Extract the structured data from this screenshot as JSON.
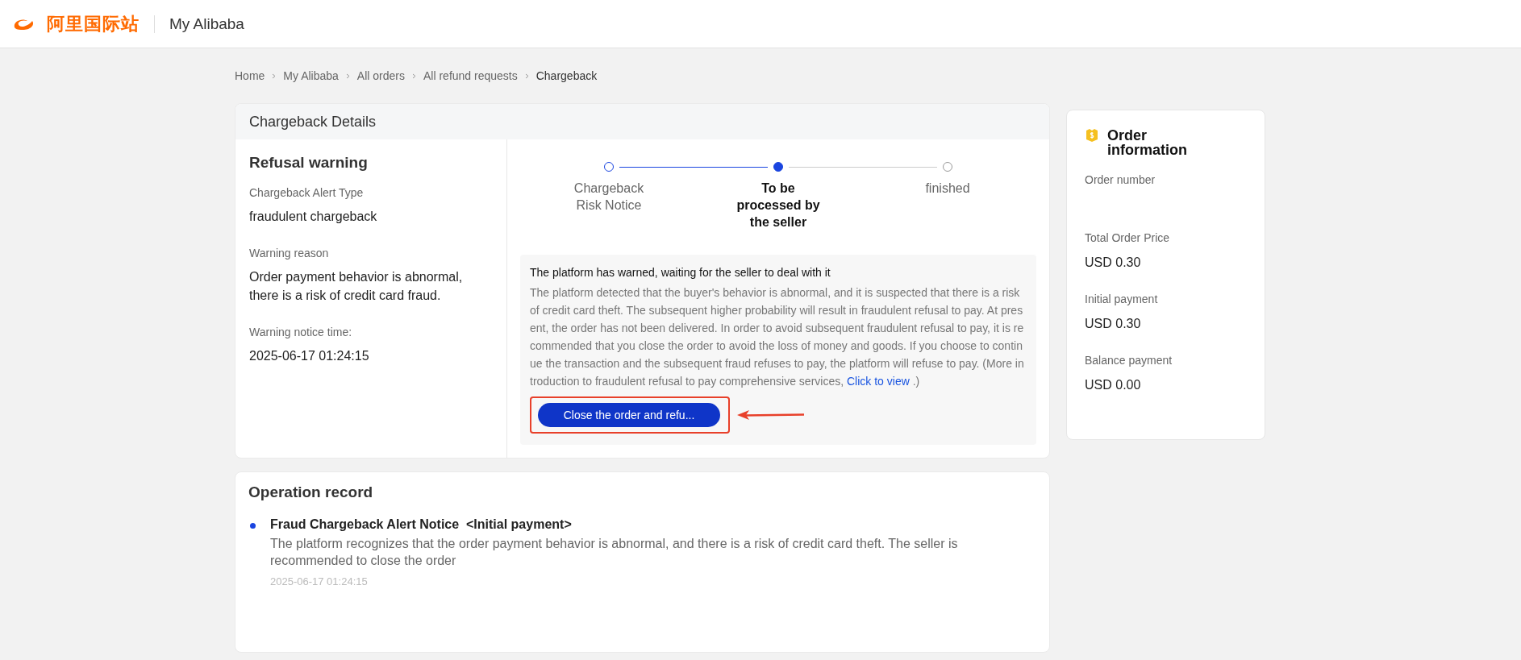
{
  "header": {
    "logo_text": "阿里国际站",
    "title": "My Alibaba"
  },
  "breadcrumb": [
    {
      "label": "Home",
      "current": false
    },
    {
      "label": "My Alibaba",
      "current": false
    },
    {
      "label": "All orders",
      "current": false
    },
    {
      "label": "All refund requests",
      "current": false
    },
    {
      "label": "Chargeback",
      "current": true
    }
  ],
  "details": {
    "title": "Chargeback Details",
    "summary": {
      "title": "Refusal warning",
      "fields": [
        {
          "label": "Chargeback Alert Type",
          "value": "fraudulent chargeback"
        },
        {
          "label": "Warning reason",
          "value": "Order payment behavior is abnormal, there is a risk of credit card fraud."
        },
        {
          "label": "Warning notice time:",
          "value": "2025-06-17 01:24:15"
        }
      ]
    },
    "steps": [
      {
        "label": "Chargeback Risk Notice",
        "completed": true,
        "selected": false
      },
      {
        "label": "To be processed by the seller",
        "completed": false,
        "selected": true
      },
      {
        "label": "finished",
        "completed": false,
        "selected": false
      }
    ],
    "notice": {
      "title": "The platform has warned, waiting for the seller to deal with it",
      "text": "The platform detected that the buyer's behavior is abnormal, and it is suspected that there is a risk of credit card theft. The subsequent higher probability will result in fraudulent refusal to pay. At present, the order has not been delivered. In order to avoid subsequent fraudulent refusal to pay, it is recommended that you close the order to avoid the loss of money and goods. If you choose to continue the transaction and the subsequent fraud refuses to pay, the platform will refuse to pay. (More introduction to fraudulent refusal to pay comprehensive services, ",
      "link": "Click to view",
      "after": " .)",
      "button": {
        "label": "Close the order and refu...",
        "highlighted": true
      }
    }
  },
  "order_info": {
    "title": "Order information",
    "items": [
      {
        "label": "Order number"
      },
      {
        "label": "Total Order Price",
        "value": "USD 0.30"
      },
      {
        "label": "Initial payment",
        "value": "USD 0.30"
      },
      {
        "label": "Balance payment",
        "value": "USD 0.00"
      }
    ]
  },
  "operation_record": {
    "title": "Operation record",
    "entries": [
      {
        "title": "Fraud Chargeback Alert Notice  <Initial payment>",
        "description": "The platform recognizes that the order payment behavior is abnormal, and there is a risk of credit card theft. The seller is recommended to close the order",
        "time": "2025-06-17 01:24:15",
        "color": "#1a45e0"
      }
    ]
  }
}
